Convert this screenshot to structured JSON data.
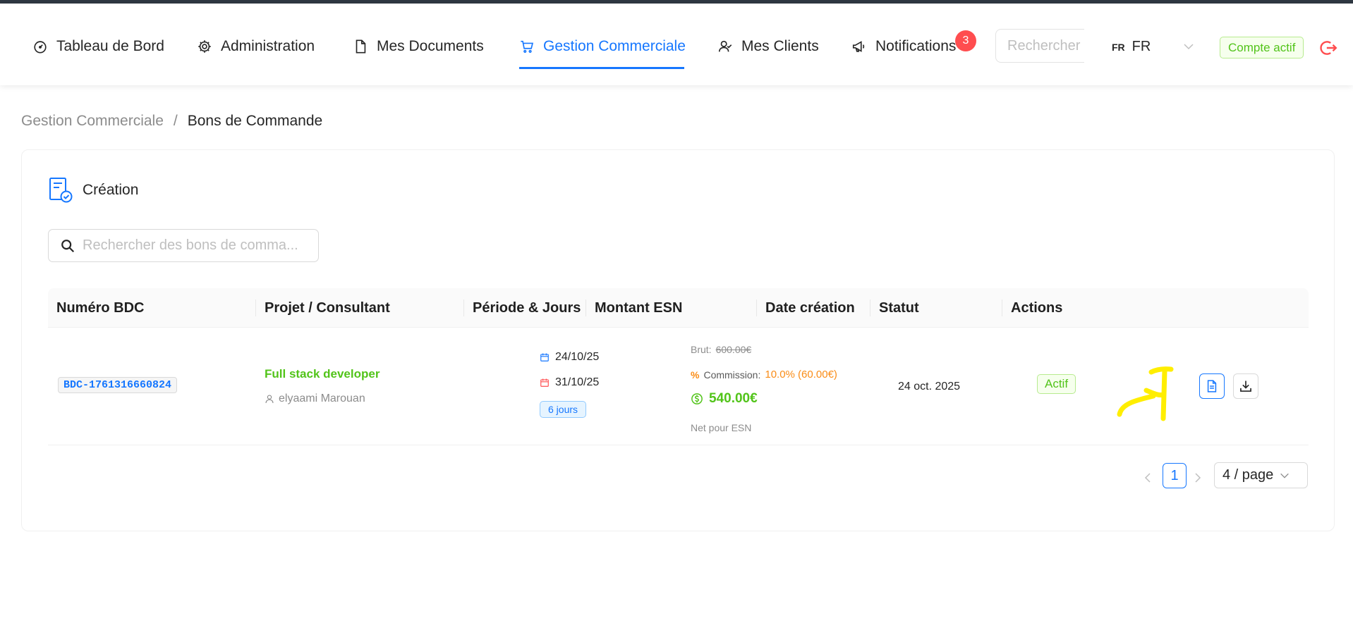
{
  "nav": {
    "items": [
      {
        "label": "Tableau de Bord",
        "icon": "dashboard-icon"
      },
      {
        "label": "Administration",
        "icon": "gear-icon"
      },
      {
        "label": "Mes Documents",
        "icon": "file-icon"
      },
      {
        "label": "Gestion Commerciale",
        "icon": "cart-icon",
        "active": true
      },
      {
        "label": "Mes Clients",
        "icon": "users-icon"
      },
      {
        "label": "Notifications",
        "icon": "megaphone-icon"
      }
    ],
    "notification_count": "3",
    "search_placeholder": "Rechercher d",
    "lang_code": "FR",
    "lang_name": "FR",
    "account_status": "Compte actif"
  },
  "breadcrumb": {
    "parent": "Gestion Commerciale",
    "separator": "/",
    "current": "Bons de Commande"
  },
  "card": {
    "title": "Création",
    "search_placeholder": "Rechercher des bons de comma..."
  },
  "table": {
    "headers": [
      "Numéro BDC",
      "Projet / Consultant",
      "Période & Jours",
      "Montant ESN",
      "Date création",
      "Statut",
      "Actions"
    ],
    "rows": [
      {
        "bdc": "BDC-1761316660824",
        "project": "Full stack developer",
        "consultant": "elyaami Marouan",
        "start_date": "24/10/25",
        "end_date": "31/10/25",
        "days": "6 jours",
        "brut_label": "Brut:",
        "brut_value": "600.00€",
        "commission_label": "Commission:",
        "commission_value": "10.0% (60.00€)",
        "net_value": "540.00€",
        "net_label": "Net pour ESN",
        "created": "24 oct. 2025",
        "status": "Actif"
      }
    ]
  },
  "pagination": {
    "current_page": "1",
    "page_size": "4 / page"
  },
  "colors": {
    "primary": "#1677ff",
    "success": "#52c41a",
    "warning": "#fa8c16",
    "danger": "#ff4d4f",
    "annotation": "#ffee00"
  }
}
